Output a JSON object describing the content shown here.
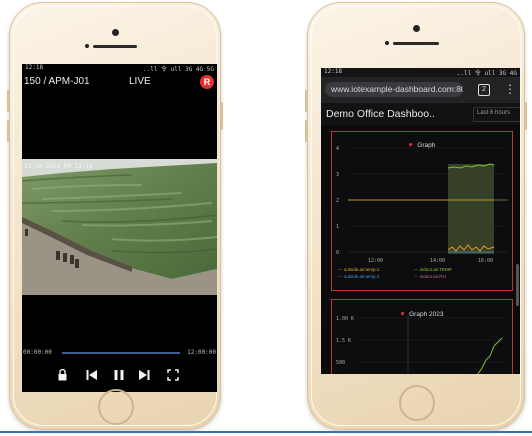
{
  "left_phone": {
    "status_time": "12:18",
    "status_right": "..ll 令 ull 3G 4G 5G",
    "camera_title": "150 / APM-J01",
    "live_badge": "LIVE",
    "record_badge": "R",
    "time_start": "00:00:00",
    "time_end": "12:00:00",
    "controls": [
      "lock",
      "previous",
      "pause",
      "next",
      "fullscreen"
    ]
  },
  "right_phone": {
    "status_time": "12:18",
    "status_right": "..ll 令 ull 3G 4G",
    "url": "www.iotexample-dashboard.com:8080/d/",
    "tab_count": "2",
    "menu_glyph": "⋮",
    "dashboard_title": "Demo Office Dashboo..",
    "panel_action": "Last 6 hours",
    "graph1": {
      "title": "Graph",
      "y_ticks": [
        "4",
        "3",
        "2",
        "1",
        "0"
      ],
      "x_ticks": [
        "12:00",
        "14:00",
        "16:00"
      ],
      "legend": [
        "--- outside.air.temp.1",
        "--- indoor.air.TEMP",
        "--- outside.air.temp.2",
        "--- indoor.air.RH"
      ],
      "legend_colors": [
        "#d9ad2c",
        "#8ac540",
        "#4a94d4",
        "#c864a8"
      ]
    },
    "graph2": {
      "title": "Graph 2023",
      "y_ticks": [
        "1.00 K",
        "1.5 K",
        "500"
      ]
    }
  },
  "colors": {
    "accent_red": "#e0322f",
    "series_green": "#7fbf3f",
    "series_orange": "#e79a22",
    "panel_bg": "#0e0e10",
    "frame": "#efe0c4"
  }
}
